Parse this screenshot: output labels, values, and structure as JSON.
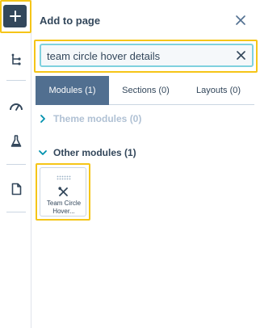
{
  "rail": {
    "items": [
      {
        "name": "add-button",
        "icon": "plus-icon"
      },
      {
        "name": "tree-icon"
      },
      {
        "name": "gauge-icon"
      },
      {
        "name": "flask-icon"
      },
      {
        "name": "document-icon"
      }
    ]
  },
  "panel": {
    "title": "Add to page",
    "search": {
      "value": "team circle hover details",
      "placeholder": ""
    },
    "tabs": [
      {
        "label": "Modules (1)",
        "active": true
      },
      {
        "label": "Sections (0)",
        "active": false
      },
      {
        "label": "Layouts (0)",
        "active": false
      }
    ],
    "theme_modules": {
      "label": "Theme modules (0)",
      "expanded": false
    },
    "other_modules": {
      "label": "Other modules (1)",
      "expanded": true
    },
    "module_card": {
      "line1": "Team Circle",
      "line2": "Hover..."
    }
  },
  "colors": {
    "accent_highlight": "#f5c518",
    "search_border": "#7fd1de",
    "active_tab": "#516f90",
    "muted_section": "#b0c1d4",
    "text_dark": "#33475b",
    "rail_button": "#33475b"
  }
}
